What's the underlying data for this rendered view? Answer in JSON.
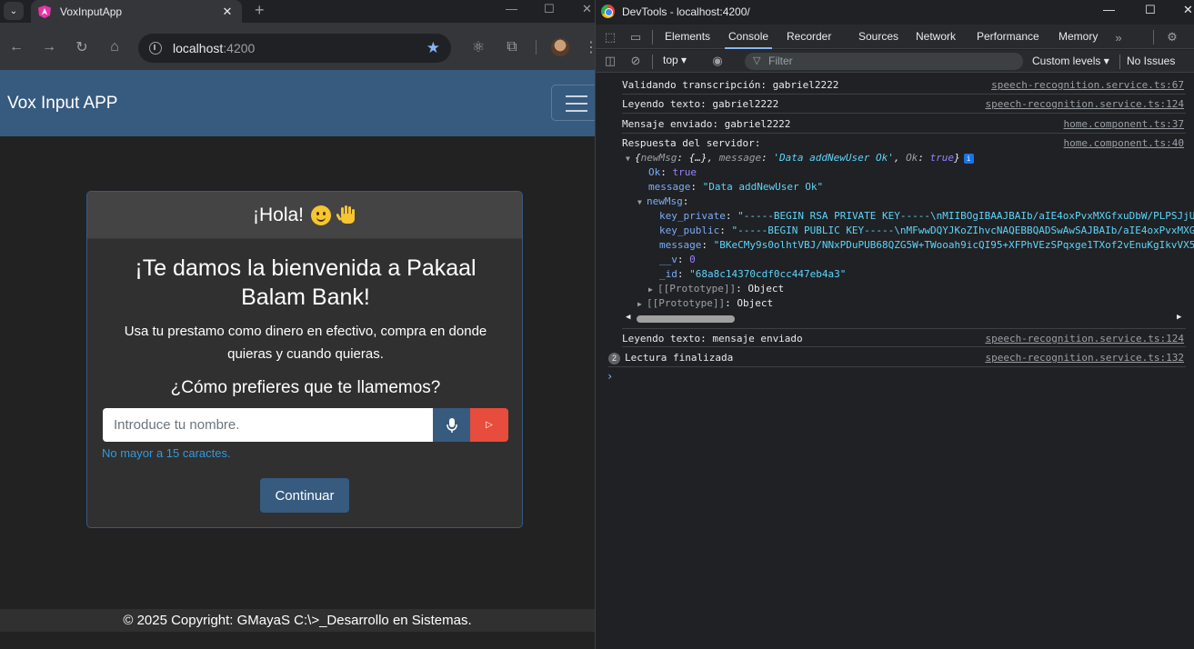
{
  "browser": {
    "tab_title": "VoxInputApp",
    "tab_close": "✕",
    "new_tab": "+",
    "url_host": "localhost",
    "url_port": ":4200"
  },
  "page": {
    "brand": "Vox Input APP",
    "card_header": "¡Hola!",
    "welcome_title": "¡Te damos la bienvenida a Pakaal Balam Bank!",
    "welcome_subtext": "Usa tu prestamo como dinero en efectivo, compra en donde quieras y cuando quieras.",
    "question": "¿Cómo prefieres que te llamemos?",
    "name_placeholder": "Introduce tu nombre.",
    "hint": "No mayor a 15 caractes.",
    "continue_label": "Continuar",
    "footer": "© 2025 Copyright: GMayaS C:\\>_Desarrollo en Sistemas.",
    "colors": {
      "navbar": "#375a7f",
      "send": "#e74c3c",
      "hint": "#3498db"
    }
  },
  "devtools": {
    "title": "DevTools - localhost:4200/",
    "tabs": [
      "Elements",
      "Console",
      "Recorder",
      "Sources",
      "Network",
      "Performance",
      "Memory"
    ],
    "active_tab": "Console",
    "context": "top ▾",
    "filter_placeholder": "Filter",
    "levels": "Custom levels ▾",
    "issues": "No Issues",
    "logs": [
      {
        "text": "Validando transcripción: gabriel2222",
        "src": "speech-recognition.service.ts:67"
      },
      {
        "text": "Leyendo texto: gabriel2222",
        "src": "speech-recognition.service.ts:124"
      },
      {
        "text": "Mensaje enviado: gabriel2222",
        "src": "home.component.ts:37"
      },
      {
        "text": "Respuesta del servidor:",
        "src": "home.component.ts:40"
      }
    ],
    "object": {
      "summary_key1": "newMsg",
      "summary_val1": "{…}",
      "summary_key2": "message",
      "summary_val2": "'Data addNewUser Ok'",
      "summary_key3": "Ok",
      "summary_val3": "true",
      "ok_key": "Ok",
      "ok_val": "true",
      "message_key": "message",
      "message_val": "\"Data addNewUser Ok\"",
      "newmsg_key": "newMsg",
      "key_private_key": "key_private",
      "key_private_val": "\"-----BEGIN RSA PRIVATE KEY-----\\nMIIBOgIBAAJBAIb/aIE4oxPvxMXGfxuDbW/PLPSJjU",
      "key_public_key": "key_public",
      "key_public_val": "\"-----BEGIN PUBLIC KEY-----\\nMFwwDQYJKoZIhvcNAQEBBQADSwAwSAJBAIb/aIE4oxPvxMXG",
      "msg_key": "message",
      "msg_val": "\"BKeCMy9s0olhtVBJ/NNxPDuPUB68QZG5W+TWooah9icQI95+XFPhVEzSPqxge1TXof2vEnuKgIkvVX5",
      "v_key": "__v",
      "v_val": "0",
      "id_key": "_id",
      "id_val": "\"68a8c14370cdf0cc447eb4a3\"",
      "proto_inner": "[[Prototype]]",
      "proto_inner_val": "Object",
      "proto_outer": "[[Prototype]]",
      "proto_outer_val": "Object"
    },
    "logs_after": [
      {
        "text": "Leyendo texto: mensaje enviado",
        "src": "speech-recognition.service.ts:124"
      },
      {
        "count": "2",
        "text": "Lectura finalizada",
        "src": "speech-recognition.service.ts:132"
      }
    ]
  }
}
